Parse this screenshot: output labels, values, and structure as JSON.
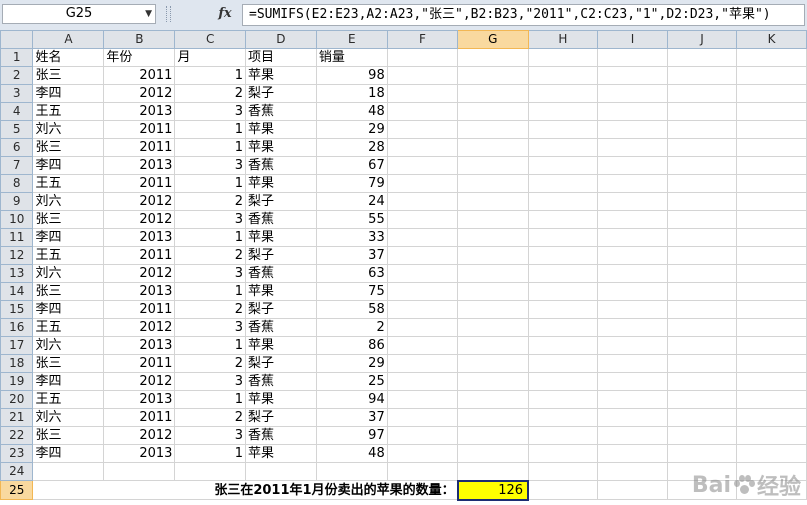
{
  "formula_bar": {
    "name_box": "G25",
    "fx_label": "fx",
    "formula": "=SUMIFS(E2:E23,A2:A23,\"张三\",B2:B23,\"2011\",C2:C23,\"1\",D2:D23,\"苹果\")"
  },
  "columns": [
    "A",
    "B",
    "C",
    "D",
    "E",
    "F",
    "G",
    "H",
    "I",
    "J",
    "K"
  ],
  "selected_column": "G",
  "selected_row": 25,
  "headers": {
    "name": "姓名",
    "year": "年份",
    "month": "月",
    "item": "项目",
    "sales": "销量"
  },
  "rows": [
    {
      "r": 2,
      "name": "张三",
      "year": "2011",
      "month": "1",
      "item": "苹果",
      "sales": "98"
    },
    {
      "r": 3,
      "name": "李四",
      "year": "2012",
      "month": "2",
      "item": "梨子",
      "sales": "18"
    },
    {
      "r": 4,
      "name": "王五",
      "year": "2013",
      "month": "3",
      "item": "香蕉",
      "sales": "48"
    },
    {
      "r": 5,
      "name": "刘六",
      "year": "2011",
      "month": "1",
      "item": "苹果",
      "sales": "29"
    },
    {
      "r": 6,
      "name": "张三",
      "year": "2011",
      "month": "1",
      "item": "苹果",
      "sales": "28"
    },
    {
      "r": 7,
      "name": "李四",
      "year": "2013",
      "month": "3",
      "item": "香蕉",
      "sales": "67"
    },
    {
      "r": 8,
      "name": "王五",
      "year": "2011",
      "month": "1",
      "item": "苹果",
      "sales": "79"
    },
    {
      "r": 9,
      "name": "刘六",
      "year": "2012",
      "month": "2",
      "item": "梨子",
      "sales": "24"
    },
    {
      "r": 10,
      "name": "张三",
      "year": "2012",
      "month": "3",
      "item": "香蕉",
      "sales": "55"
    },
    {
      "r": 11,
      "name": "李四",
      "year": "2013",
      "month": "1",
      "item": "苹果",
      "sales": "33"
    },
    {
      "r": 12,
      "name": "王五",
      "year": "2011",
      "month": "2",
      "item": "梨子",
      "sales": "37"
    },
    {
      "r": 13,
      "name": "刘六",
      "year": "2012",
      "month": "3",
      "item": "香蕉",
      "sales": "63"
    },
    {
      "r": 14,
      "name": "张三",
      "year": "2013",
      "month": "1",
      "item": "苹果",
      "sales": "75"
    },
    {
      "r": 15,
      "name": "李四",
      "year": "2011",
      "month": "2",
      "item": "梨子",
      "sales": "58"
    },
    {
      "r": 16,
      "name": "王五",
      "year": "2012",
      "month": "3",
      "item": "香蕉",
      "sales": "2"
    },
    {
      "r": 17,
      "name": "刘六",
      "year": "2013",
      "month": "1",
      "item": "苹果",
      "sales": "86"
    },
    {
      "r": 18,
      "name": "张三",
      "year": "2011",
      "month": "2",
      "item": "梨子",
      "sales": "29"
    },
    {
      "r": 19,
      "name": "李四",
      "year": "2012",
      "month": "3",
      "item": "香蕉",
      "sales": "25"
    },
    {
      "r": 20,
      "name": "王五",
      "year": "2013",
      "month": "1",
      "item": "苹果",
      "sales": "94"
    },
    {
      "r": 21,
      "name": "刘六",
      "year": "2011",
      "month": "2",
      "item": "梨子",
      "sales": "37"
    },
    {
      "r": 22,
      "name": "张三",
      "year": "2012",
      "month": "3",
      "item": "香蕉",
      "sales": "97"
    },
    {
      "r": 23,
      "name": "李四",
      "year": "2013",
      "month": "1",
      "item": "苹果",
      "sales": "48"
    }
  ],
  "result": {
    "label": "张三在2011年1月份卖出的苹果的数量：",
    "value": "126"
  },
  "watermark": {
    "text": "Bai",
    "text2": "经验"
  },
  "colors": {
    "selection": "#ffff00",
    "selection_border": "#1c2d73",
    "header_highlight": "#f9d99f"
  }
}
